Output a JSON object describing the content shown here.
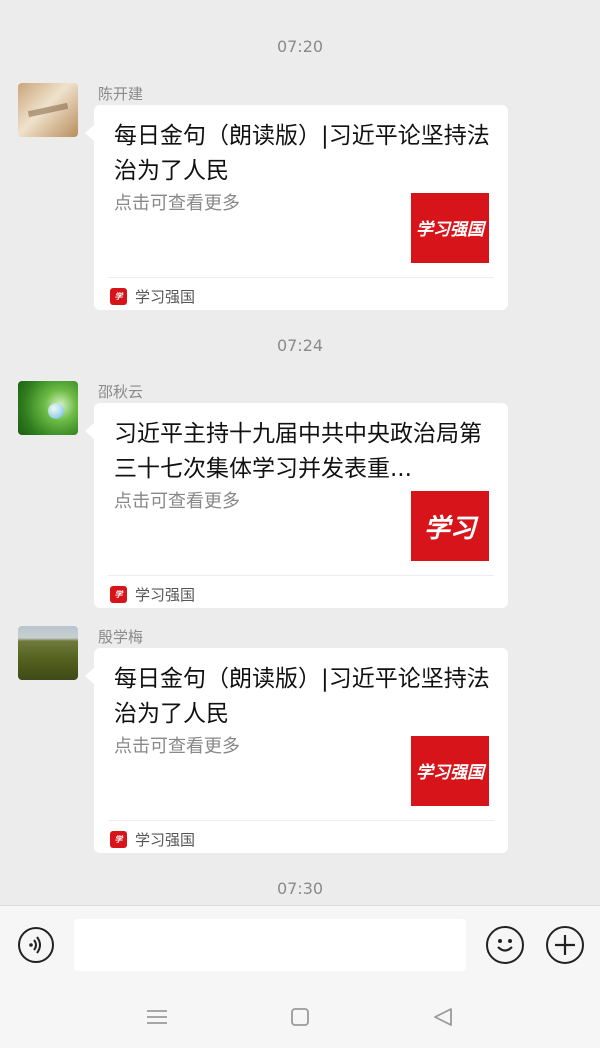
{
  "colors": {
    "brand_red": "#d7141a",
    "background": "#ececec"
  },
  "timestamps": [
    "07:20",
    "07:24",
    "07:30"
  ],
  "messages": [
    {
      "sender": "陈开建",
      "title": "每日金句（朗读版）|习近平论坚持法治为了人民",
      "desc": "点击可查看更多",
      "thumb_text": "学习强国",
      "source": "学习强国"
    },
    {
      "sender": "邵秋云",
      "title": "习近平主持十九届中共中央政治局第三十七次集体学习并发表重...",
      "desc": "点击可查看更多",
      "thumb_text": "学习",
      "source": "学习强国"
    },
    {
      "sender": "殷学梅",
      "title": "每日金句（朗读版）|习近平论坚持法治为了人民",
      "desc": "点击可查看更多",
      "thumb_text": "学习强国",
      "source": "学习强国"
    }
  ],
  "icons": {
    "voice": "voice-icon",
    "emoji": "emoji-icon",
    "plus": "plus-icon",
    "menu": "menu-icon",
    "home": "home-icon",
    "back": "back-icon"
  }
}
